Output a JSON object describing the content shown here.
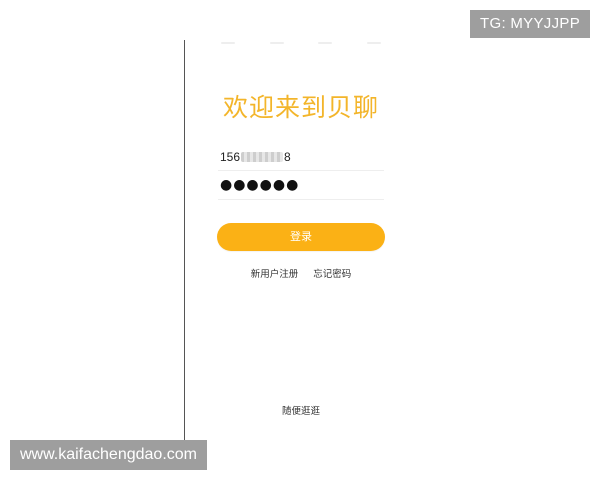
{
  "watermarks": {
    "tg": "TG: MYYJJPP",
    "site": "www.kaifachengdao.com"
  },
  "login": {
    "title": "欢迎来到贝聊",
    "phone_prefix": "156",
    "phone_suffix": "8",
    "password_mask": "●●●●●●",
    "login_label": "登录",
    "register_label": "新用户注册",
    "forgot_label": "忘记密码",
    "browse_label": "随便逛逛"
  },
  "colors": {
    "accent": "#fbb115",
    "title": "#f3b52a"
  }
}
